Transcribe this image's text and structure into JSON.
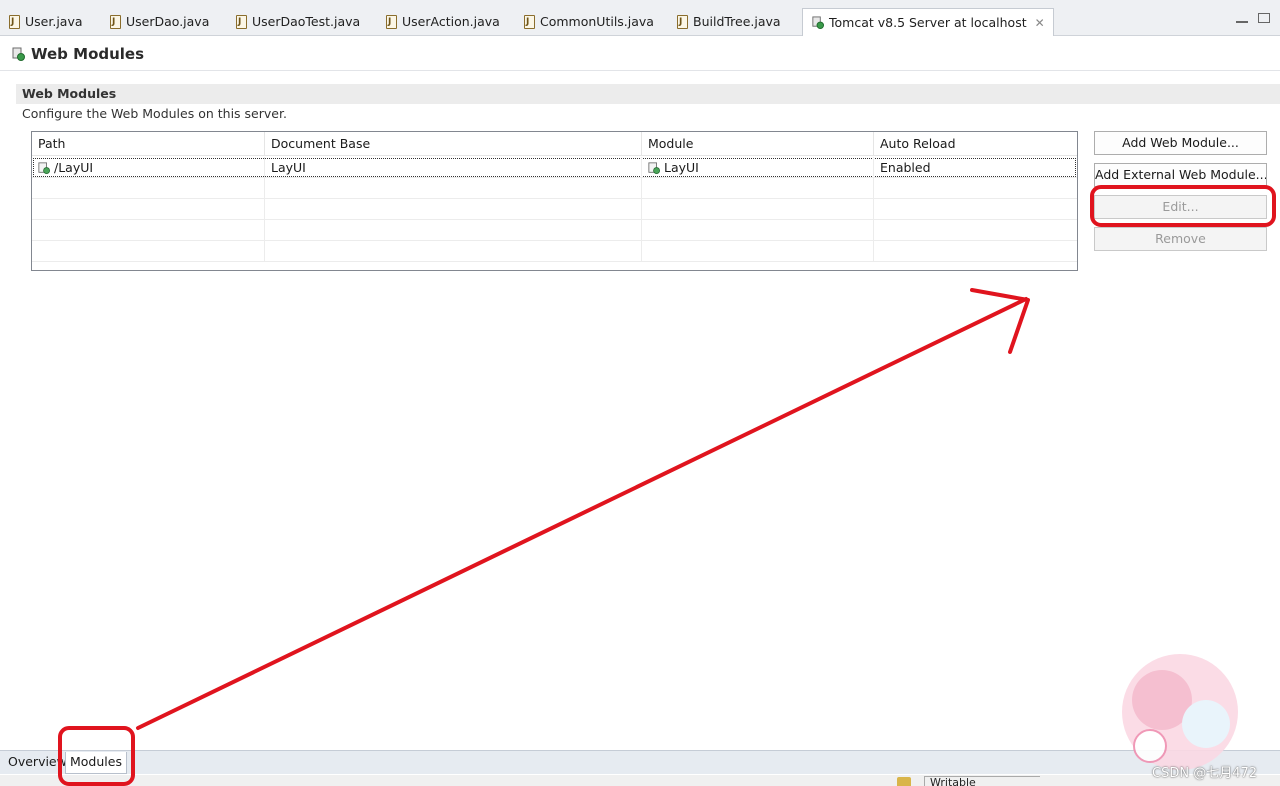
{
  "editor_tabs": [
    {
      "label": "User.java"
    },
    {
      "label": "UserDao.java"
    },
    {
      "label": "UserDaoTest.java"
    },
    {
      "label": "UserAction.java"
    },
    {
      "label": "CommonUtils.java"
    },
    {
      "label": "BuildTree.java"
    }
  ],
  "active_tab": {
    "label": "Tomcat v8.5 Server at localhost",
    "close": "✕"
  },
  "page": {
    "title": "Web Modules"
  },
  "section": {
    "title": "Web Modules",
    "description": "Configure the Web Modules on this server."
  },
  "table": {
    "columns": [
      "Path",
      "Document Base",
      "Module",
      "Auto Reload"
    ],
    "rows": [
      {
        "path": "/LayUI",
        "document_base": "LayUI",
        "module": "LayUI",
        "auto_reload": "Enabled"
      }
    ]
  },
  "buttons": {
    "add_web_module": "Add Web Module...",
    "add_external_web_module": "Add External Web Module...",
    "edit": "Edit...",
    "remove": "Remove"
  },
  "page_tabs": [
    {
      "label": "Overview"
    },
    {
      "label": "Modules"
    }
  ],
  "status": {
    "field": "Writable"
  },
  "watermark": "CSDN @七月472",
  "colors": {
    "annotation": "#e0141e",
    "accent": "#c6cbd2"
  }
}
